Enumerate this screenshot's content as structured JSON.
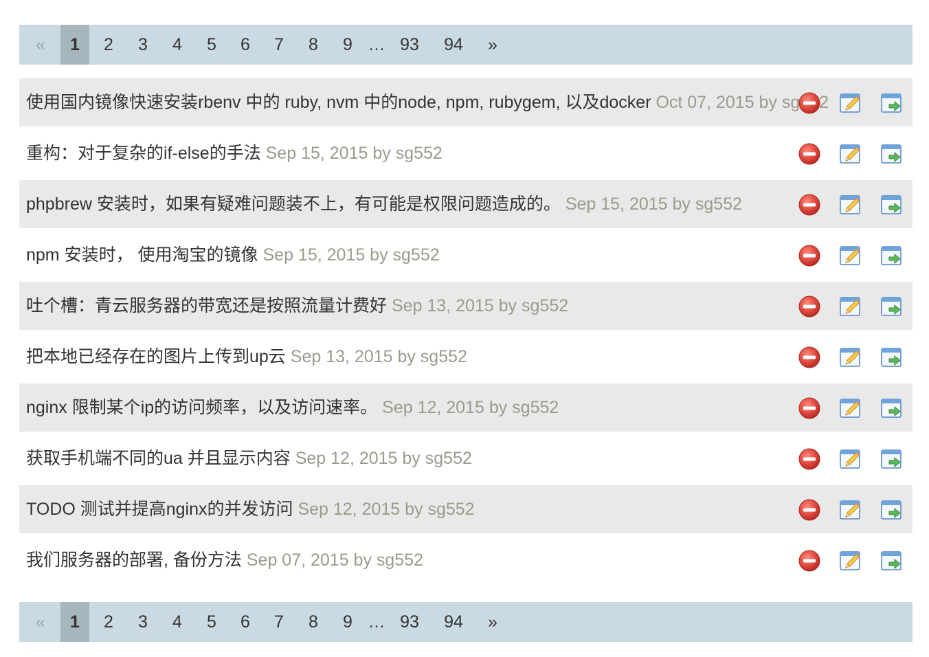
{
  "pagination": {
    "prev": "«",
    "current": "1",
    "pages": [
      "2",
      "3",
      "4",
      "5",
      "6",
      "7",
      "8",
      "9"
    ],
    "gap": "…",
    "last_pages": [
      "93",
      "94"
    ],
    "next": "»"
  },
  "posts": [
    {
      "title": "使用国内镜像快速安装rbenv 中的 ruby, nvm 中的node, npm, rubygem, 以及docker",
      "meta": "Oct 07, 2015 by sg552"
    },
    {
      "title": "重构：对于复杂的if-else的手法",
      "meta": "Sep 15, 2015 by sg552"
    },
    {
      "title": "phpbrew 安装时，如果有疑难问题装不上，有可能是权限问题造成的。",
      "meta": "Sep 15, 2015 by sg552"
    },
    {
      "title": "npm 安装时， 使用淘宝的镜像",
      "meta": "Sep 15, 2015 by sg552"
    },
    {
      "title": "吐个槽：青云服务器的带宽还是按照流量计费好",
      "meta": "Sep 13, 2015 by sg552"
    },
    {
      "title": "把本地已经存在的图片上传到up云",
      "meta": "Sep 13, 2015 by sg552"
    },
    {
      "title": "nginx 限制某个ip的访问频率，以及访问速率。",
      "meta": "Sep 12, 2015 by sg552"
    },
    {
      "title": "获取手机端不同的ua 并且显示内容",
      "meta": "Sep 12, 2015 by sg552"
    },
    {
      "title": "TODO 测试并提高nginx的并发访问",
      "meta": "Sep 12, 2015 by sg552"
    },
    {
      "title": "我们服务器的部署, 备份方法",
      "meta": "Sep 07, 2015 by sg552"
    }
  ],
  "icons": {
    "delete": "delete-icon",
    "edit": "edit-icon",
    "move": "move-icon"
  },
  "colors": {
    "pager_bg": "#c9dae2",
    "pager_current": "#a6b6bd",
    "row_alt": "#e9e9e9",
    "meta": "#9b9a8c",
    "delete_red": "#e04a3f"
  }
}
